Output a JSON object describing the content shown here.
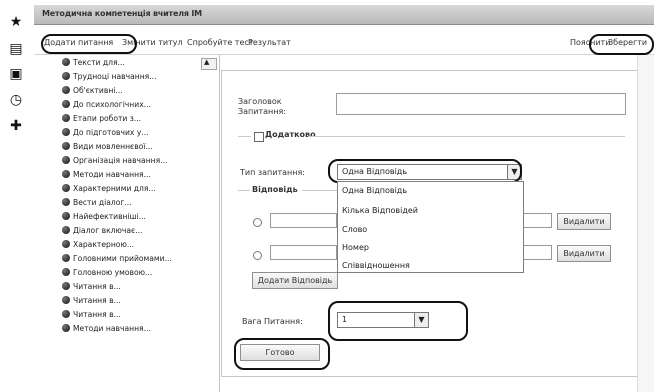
{
  "left_rail": {
    "icons": [
      "star-icon",
      "document-icon",
      "window-icon",
      "clock-icon",
      "plus-icon"
    ]
  },
  "title": "Методична компетенція вчителя ІМ",
  "toolbar": {
    "items": [
      "Додати питання",
      "Змінити титул",
      "Спробуйте тест",
      "Результат",
      "Пояснити",
      "Зберегти"
    ]
  },
  "tree": {
    "items": [
      "Тексти для...",
      "Трудноці навчання...",
      "Об'єктивні...",
      "До психологічних...",
      "Етапи роботи з...",
      "До підготовчих у...",
      "Види мовленнєвої...",
      "Організація навчання...",
      "Методи навчання...",
      "Характерними для...",
      "Вести діалог...",
      "Найефективніші...",
      "Діалог включає...",
      "Характерною...",
      "Головними прийомами...",
      "Головною умовою...",
      "Читання в...",
      "Читання в...",
      "Читання в...",
      "Методи навчання..."
    ]
  },
  "form": {
    "question_header_label_line1": "Заголовок",
    "question_header_label_line2": "Запитання:",
    "additional_label": "Додатково",
    "question_type_label": "Тип запитання:",
    "question_type_value": "Одна Відповідь",
    "question_type_options": [
      "Одна Відповідь",
      "Кілька Відповідей",
      "Слово",
      "Номер",
      "Співвідношення"
    ],
    "answer_section_label": "Відповідь",
    "remove_button": "Видалити",
    "add_answer_button": "Додати Відповідь",
    "question_weight_label": "Вага Питання:",
    "question_weight_value": "1",
    "done_button": "Готово"
  }
}
